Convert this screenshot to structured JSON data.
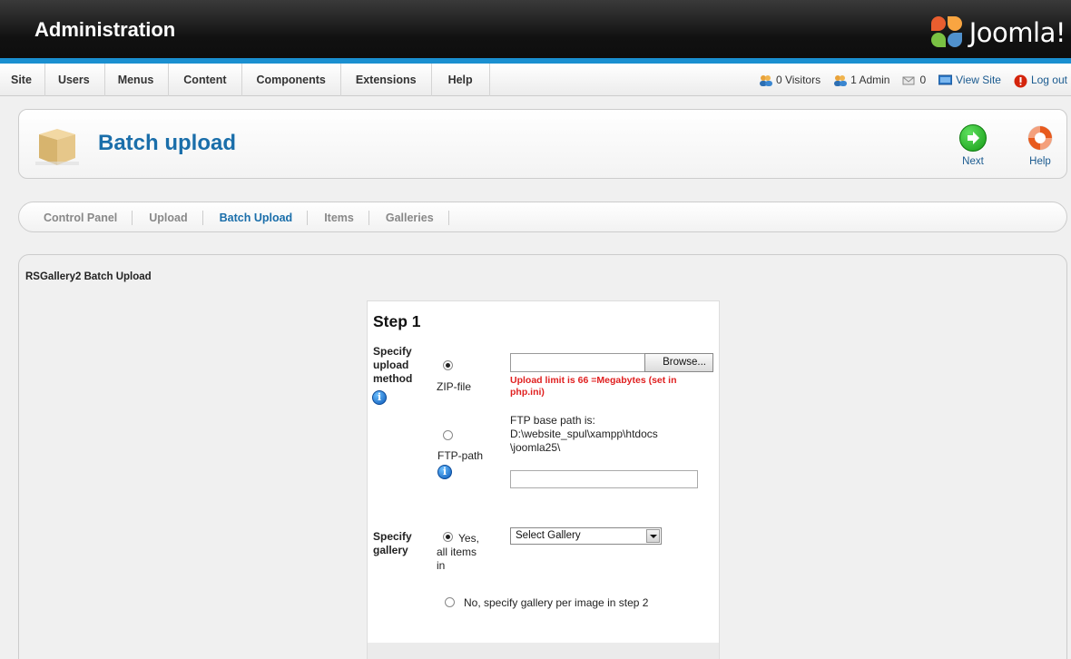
{
  "header": {
    "title": "Administration",
    "brand": "Joomla!"
  },
  "menu": [
    "Site",
    "Users",
    "Menus",
    "Content",
    "Components",
    "Extensions",
    "Help"
  ],
  "status": {
    "visitors": "0 Visitors",
    "admins": "1 Admin",
    "messages": "0",
    "view_site": "View Site",
    "logout": "Log out"
  },
  "toolbar": {
    "title": "Batch upload",
    "next_label": "Next",
    "help_label": "Help"
  },
  "subnav": [
    "Control Panel",
    "Upload",
    "Batch Upload",
    "Items",
    "Galleries"
  ],
  "content": {
    "heading": "RSGallery2 Batch Upload",
    "step_title": "Step 1",
    "method_label": [
      "Specify",
      "upload",
      "method"
    ],
    "zip_label": "ZIP-file",
    "browse_label": "Browse...",
    "upload_limit": [
      "Upload limit is 66 =Megabytes (set in",
      "php.ini)"
    ],
    "ftp_label": "FTP-path",
    "ftp_base": [
      "FTP base path is:",
      "D:\\website_spul\\xampp\\htdocs",
      "\\joomla25\\"
    ],
    "gallery_label": [
      "Specify",
      "gallery"
    ],
    "yes_label": [
      "Yes,",
      "all items",
      "in"
    ],
    "select_gallery": "Select Gallery",
    "no_label": "No, specify gallery per image in step 2"
  },
  "colors": {
    "accent": "#1a6eaa",
    "brand_bar": "#1a8fd0",
    "warning": "#e02020"
  }
}
